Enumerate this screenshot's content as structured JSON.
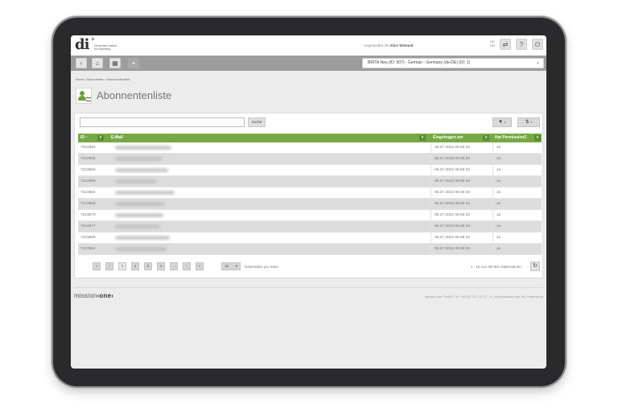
{
  "header": {
    "logo_text": "di",
    "logo_plus": "+",
    "logo_subtitle": "Deutsches Institut für Marketing",
    "logged_in_prefix": "Angemeldet als",
    "logged_in_user": "Alice Wieland",
    "lang_top": "DE",
    "lang_bottom": "EN"
  },
  "nav": {
    "back_label": "‹",
    "home_label": "⌂",
    "grid_label": "▦",
    "add_label": "+",
    "newsletter_selected": "BRITA Neu (ID: 507) - German - Germany (de-DE) (ID: 1)"
  },
  "breadcrumb": "Home › Abonnenten › Abonnentenliste",
  "page_title": "Abonnentenliste",
  "search": {
    "placeholder": "",
    "button_label": "Suche"
  },
  "table": {
    "columns": [
      "ID",
      "E-Mail",
      "Eingetragen am",
      "Hat Permission2"
    ],
    "sort_indicator": "↑",
    "rows": [
      {
        "id": "7223894",
        "date": "06.07.2022 05:59:33",
        "permission": "Ja"
      },
      {
        "id": "7223892",
        "date": "06.07.2022 05:59:33",
        "permission": "Ja"
      },
      {
        "id": "7223890",
        "date": "06.07.2022 05:59:33",
        "permission": "Ja"
      },
      {
        "id": "7223889",
        "date": "06.07.2022 05:59:33",
        "permission": "Ja"
      },
      {
        "id": "7223884",
        "date": "06.07.2022 05:59:33",
        "permission": "Ja"
      },
      {
        "id": "7223880",
        "date": "06.07.2022 05:59:33",
        "permission": "Ja"
      },
      {
        "id": "7223878",
        "date": "06.07.2022 05:59:33",
        "permission": "Ja"
      },
      {
        "id": "7223877",
        "date": "06.07.2022 05:59:33",
        "permission": "Ja"
      },
      {
        "id": "7223866",
        "date": "06.07.2022 05:59:33",
        "permission": "Ja"
      },
      {
        "id": "7223864",
        "date": "06.07.2022 05:59:33",
        "permission": "Ja"
      }
    ]
  },
  "pager": {
    "first": "«",
    "prev": "‹",
    "pages": [
      "1",
      "2",
      "3",
      "4",
      "..."
    ],
    "next": "›",
    "last": "»",
    "per_page": "10",
    "per_page_label": "Datensätze pro Seite",
    "record_info": "1 - 10 von 457461 Datensätzen"
  },
  "footer": {
    "brand_prefix": "mission",
    "brand_bold": "‹one›",
    "info": "mission-one GmbH | Tel +49 (0) 731 | 20 77 - 0 | info@mission-one.de | Impressum"
  },
  "colors": {
    "accent_green": "#76a945",
    "bezel": "#2a2a2c",
    "navbar": "#9d9d9d"
  }
}
